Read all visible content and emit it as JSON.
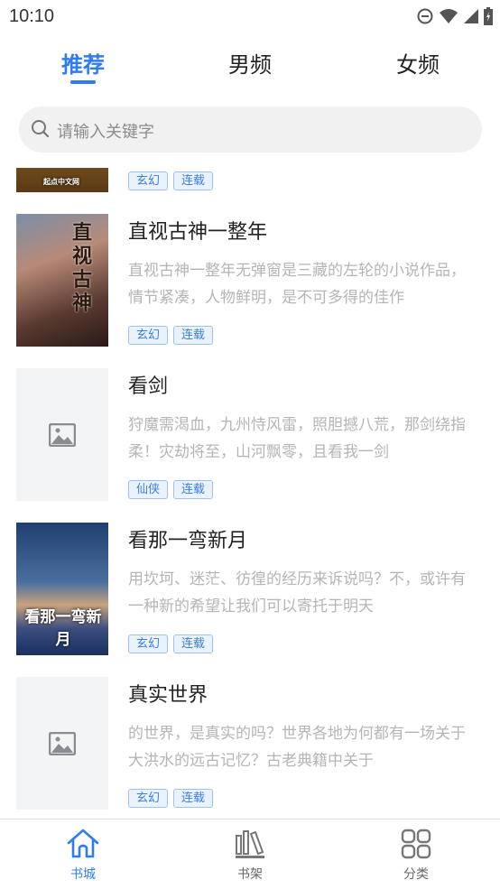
{
  "status": {
    "time": "10:10"
  },
  "tabs": [
    {
      "label": "推荐",
      "active": true
    },
    {
      "label": "男频"
    },
    {
      "label": "女频"
    }
  ],
  "search": {
    "placeholder": "请输入关键字"
  },
  "accent": "#2f7cf0",
  "books": [
    {
      "title": "",
      "desc": "",
      "tags": [
        "玄幻",
        "连载"
      ],
      "cover": "image",
      "cover_text": "起点中文网"
    },
    {
      "title": "直视古神一整年",
      "desc": "直视古神一整年无弹窗是三藏的左轮的小说作品，情节紧凑，人物鲜明，是不可多得的佳作",
      "tags": [
        "玄幻",
        "连载"
      ],
      "cover": "image",
      "cover_text": "直视古神"
    },
    {
      "title": "看剑",
      "desc": "狩魔需渴血，九州恃风雷，照胆撼八荒，那剑绕指柔！灾劫将至，山河飘零，且看我一剑",
      "tags": [
        "仙侠",
        "连载"
      ],
      "cover": "placeholder"
    },
    {
      "title": "看那一弯新月",
      "desc": "用坎坷、迷茫、彷徨的经历来诉说吗？不，或许有一种新的希望让我们可以寄托于明天",
      "tags": [
        "玄幻",
        "连载"
      ],
      "cover": "image",
      "cover_text": "看那一弯新月"
    },
    {
      "title": "真实世界",
      "desc": "的世界，是真实的吗？世界各地为何都有一场关于大洪水的远古记忆？古老典籍中关于",
      "tags": [
        "玄幻",
        "连载"
      ],
      "cover": "placeholder"
    }
  ],
  "nav": [
    {
      "label": "书城",
      "icon": "home-icon",
      "active": true
    },
    {
      "label": "书架",
      "icon": "bookshelf-icon"
    },
    {
      "label": "分类",
      "icon": "category-grid-icon"
    }
  ]
}
